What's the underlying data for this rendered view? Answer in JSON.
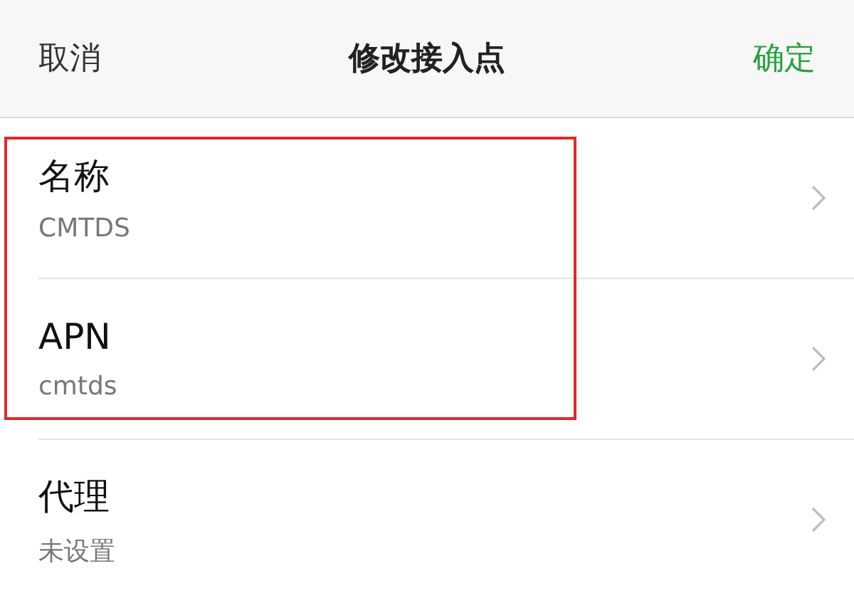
{
  "header": {
    "cancel": "取消",
    "title": "修改接入点",
    "confirm": "确定"
  },
  "items": [
    {
      "label": "名称",
      "value": "CMTDS",
      "highlighted": true
    },
    {
      "label": "APN",
      "value": "cmtds",
      "highlighted": true
    },
    {
      "label": "代理",
      "value": "未设置",
      "highlighted": false
    }
  ]
}
